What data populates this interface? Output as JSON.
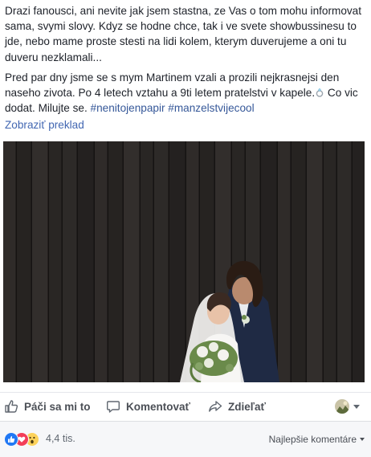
{
  "post": {
    "paragraph1": "Drazi fanousci, ani nevite jak jsem stastna, ze Vas o tom mohu informovat sama, svymi slovy. Kdyz se hodne chce, tak i ve svete showbussinesu to jde, nebo mame proste stesti na lidi kolem, kterym duverujeme a oni tu duveru nezklamali...",
    "paragraph2_text": "Pred par dny jsme se s mym Martinem vzali a prozili nejkrasnejsi den naseho zivota. Po 4 letech vztahu a 9ti letem pratelstvi v kapele.",
    "paragraph2_tail": " Co vic dodat. Milujte se. ",
    "hashtags": [
      "#nenitojenpapir",
      "#manzelstvijecool"
    ],
    "ring_icon": "ring-emoji-icon"
  },
  "translate_link": "Zobraziť preklad",
  "photo": {
    "icon": "wedding-photo",
    "colors": {
      "planks": "#2b2826",
      "plank_dark": "#1c1a19",
      "dress": "#f3f2f0",
      "suit": "#1f2a44",
      "bouquet": "#6a8a4a"
    }
  },
  "actions": {
    "like": "Páči sa mi to",
    "comment": "Komentovať",
    "share": "Zdieľať"
  },
  "reactions": {
    "icons": [
      "like-reaction-icon",
      "love-reaction-icon",
      "wow-reaction-icon"
    ],
    "count": "4,4 tis.",
    "sort_label": "Najlepšie komentáre"
  },
  "colors": {
    "text": "#1d2129",
    "link": "#4267b2",
    "hashtag": "#365899",
    "action_text": "#4b4f56",
    "like_blue": "#2078f4",
    "love_red": "#f33e58",
    "wow_yellow": "#fcd25b"
  }
}
